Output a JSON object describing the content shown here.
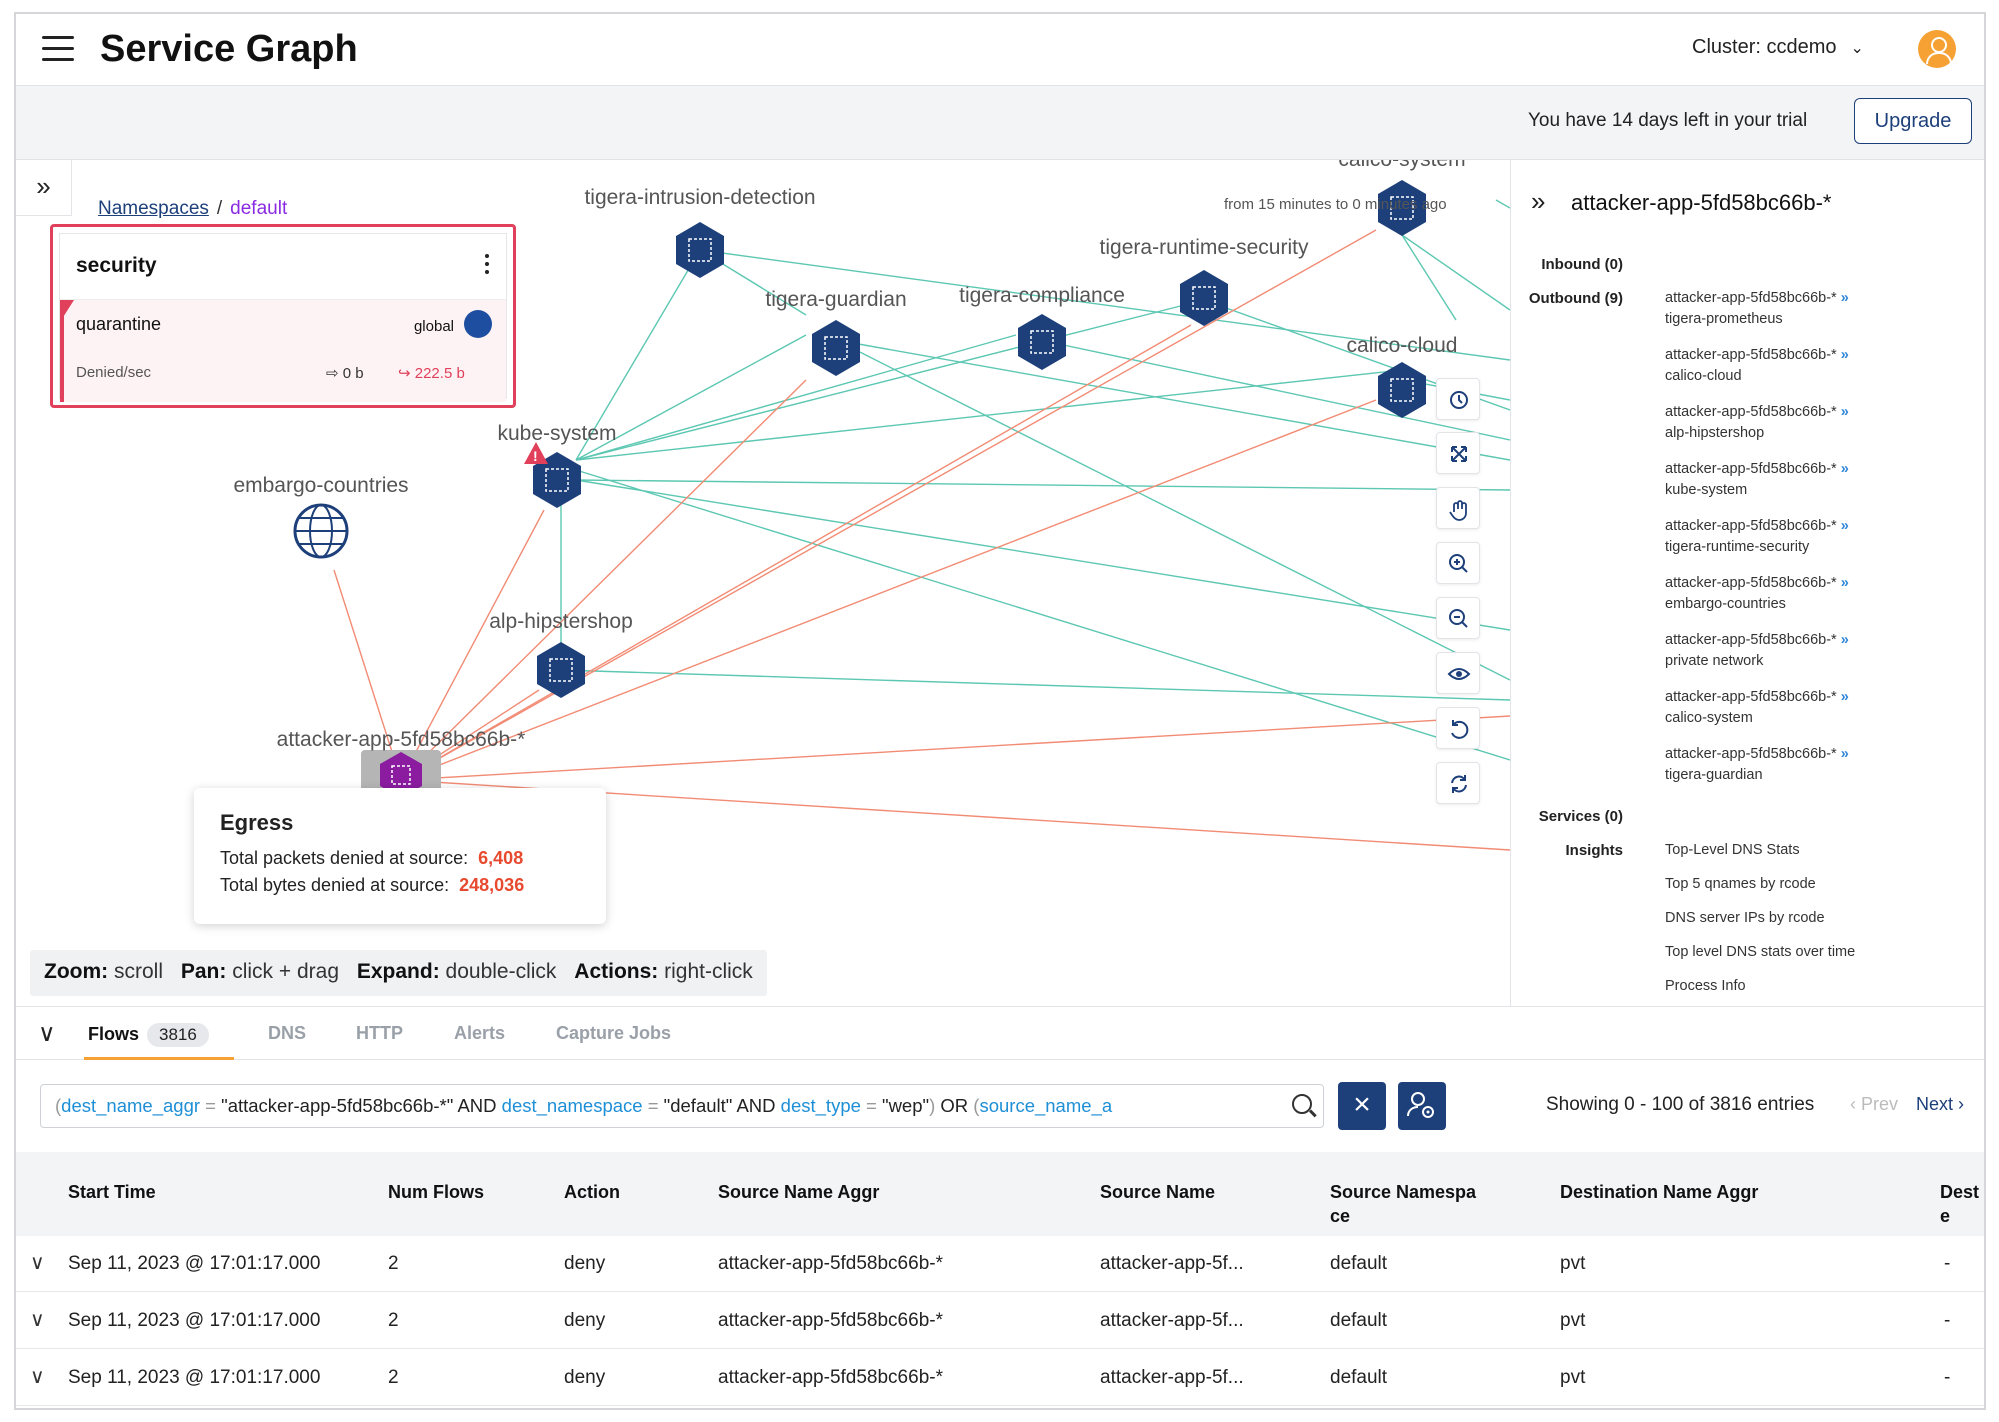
{
  "header": {
    "title": "Service Graph",
    "cluster_label": "Cluster: ccdemo"
  },
  "trial": {
    "text": "You have 14 days left in your trial",
    "upgrade_label": "Upgrade"
  },
  "graph": {
    "breadcrumb_root": "Namespaces",
    "breadcrumb_sep": "/",
    "breadcrumb_current": "default",
    "time_range": "from 15 minutes to 0 minutes ago",
    "policy_card": {
      "title": "security",
      "policy_name": "quarantine",
      "scope": "global",
      "metric_label": "Denied/sec",
      "inbound": "0 b",
      "outbound": "222.5 b"
    },
    "nodes": {
      "intrusion": "tigera-intrusion-detection",
      "calico_system": "calico-system",
      "runtime": "tigera-runtime-security",
      "guardian": "tigera-guardian",
      "compliance": "tigera-compliance",
      "calico_cloud": "calico-cloud",
      "kube": "kube-system",
      "embargo": "embargo-countries",
      "alp": "alp-hipstershop",
      "attacker": "attacker-app-5fd58bc66b-*"
    },
    "egress": {
      "title": "Egress",
      "packets_label": "Total packets denied at source:",
      "packets_value": "6,408",
      "bytes_label": "Total bytes denied at source:",
      "bytes_value": "248,036"
    },
    "hints": {
      "zoom_key": "Zoom:",
      "zoom_val": "scroll",
      "pan_key": "Pan:",
      "pan_val": "click + drag",
      "expand_key": "Expand:",
      "expand_val": "double-click",
      "actions_key": "Actions:",
      "actions_val": "right-click"
    }
  },
  "side_panel": {
    "title": "attacker-app-5fd58bc66b-*",
    "inbound_label": "Inbound (0)",
    "outbound_label": "Outbound (9)",
    "outbound": [
      {
        "source": "attacker-app-5fd58bc66b-*",
        "target": "tigera-prometheus"
      },
      {
        "source": "attacker-app-5fd58bc66b-*",
        "target": "calico-cloud"
      },
      {
        "source": "attacker-app-5fd58bc66b-*",
        "target": "alp-hipstershop"
      },
      {
        "source": "attacker-app-5fd58bc66b-*",
        "target": "kube-system"
      },
      {
        "source": "attacker-app-5fd58bc66b-*",
        "target": "tigera-runtime-security"
      },
      {
        "source": "attacker-app-5fd58bc66b-*",
        "target": "embargo-countries"
      },
      {
        "source": "attacker-app-5fd58bc66b-*",
        "target": "private network"
      },
      {
        "source": "attacker-app-5fd58bc66b-*",
        "target": "calico-system"
      },
      {
        "source": "attacker-app-5fd58bc66b-*",
        "target": "tigera-guardian"
      }
    ],
    "services_label": "Services (0)",
    "insights_label": "Insights",
    "insights": [
      "Top-Level DNS Stats",
      "Top 5 qnames by rcode",
      "DNS server IPs by rcode",
      "Top level DNS stats over time",
      "Process Info"
    ]
  },
  "tabs": [
    {
      "label": "Flows",
      "count": "3816"
    },
    {
      "label": "DNS"
    },
    {
      "label": "HTTP"
    },
    {
      "label": "Alerts"
    },
    {
      "label": "Capture Jobs"
    }
  ],
  "search": {
    "k1": "dest_name_aggr",
    "v1": "\"attacker-app-5fd58bc66b-*\"",
    "and1": "AND",
    "k2": "dest_namespace",
    "v2": "\"default\"",
    "and2": "AND",
    "k3": "dest_type",
    "v3": "\"wep\"",
    "or1": "OR",
    "k4": "source_name_a",
    "eq": "="
  },
  "pagination": {
    "entries": "Showing 0 - 100 of 3816 entries",
    "prev": "Prev",
    "next": "Next"
  },
  "table": {
    "columns": [
      "Start Time",
      "Num Flows",
      "Action",
      "Source Name Aggr",
      "Source Name",
      "Source Namespa ce",
      "Destination Name Aggr",
      "Dest e"
    ],
    "rows": [
      [
        "Sep 11, 2023 @ 17:01:17.000",
        "2",
        "deny",
        "attacker-app-5fd58bc66b-*",
        "attacker-app-5f...",
        "default",
        "pvt",
        "-"
      ],
      [
        "Sep 11, 2023 @ 17:01:17.000",
        "2",
        "deny",
        "attacker-app-5fd58bc66b-*",
        "attacker-app-5f...",
        "default",
        "pvt",
        "-"
      ],
      [
        "Sep 11, 2023 @ 17:01:17.000",
        "2",
        "deny",
        "attacker-app-5fd58bc66b-*",
        "attacker-app-5f...",
        "default",
        "pvt",
        "-"
      ]
    ]
  },
  "colors": {
    "brand_navy": "#1d3f7a",
    "allow_edge": "#5cc7b2",
    "deny_edge": "#f28b74",
    "alert_red": "#e0405a",
    "accent_orange": "#f5a133"
  }
}
